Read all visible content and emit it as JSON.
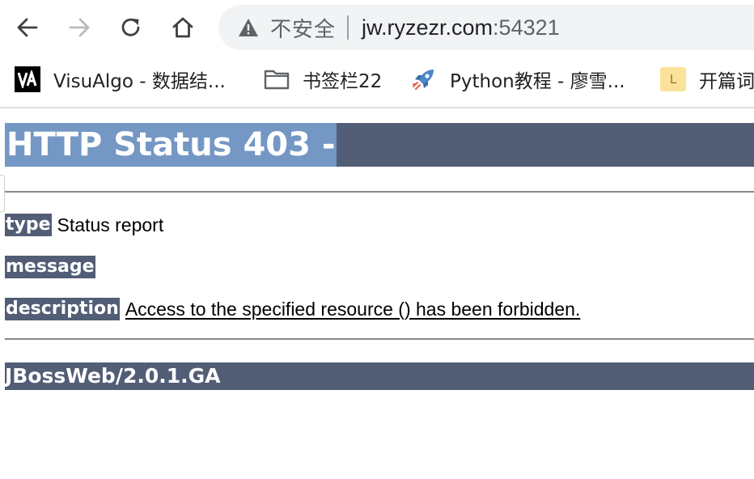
{
  "browser": {
    "security_label": "不安全",
    "url_host": "jw.ryzezr.com",
    "url_port": ":54321"
  },
  "bookmarks": [
    {
      "label": "VisuAlgo - 数据结...",
      "icon": "visualgo-favicon"
    },
    {
      "label": "书签栏22",
      "icon": "folder-icon"
    },
    {
      "label": "Python教程 - 廖雪...",
      "icon": "rocket-icon"
    },
    {
      "label": "开篇词",
      "icon": "letter-l-favicon",
      "icon_letter": "L"
    }
  ],
  "page": {
    "title": "HTTP Status 403 -",
    "fields": [
      {
        "label": "type",
        "value": "Status report"
      },
      {
        "label": "message",
        "value": ""
      },
      {
        "label": "description",
        "value": "Access to the specified resource () has been forbidden."
      }
    ],
    "footer": "JBossWeb/2.0.1.GA"
  },
  "colors": {
    "header_bar": "#525d76",
    "title_highlight": "#7497c4"
  }
}
